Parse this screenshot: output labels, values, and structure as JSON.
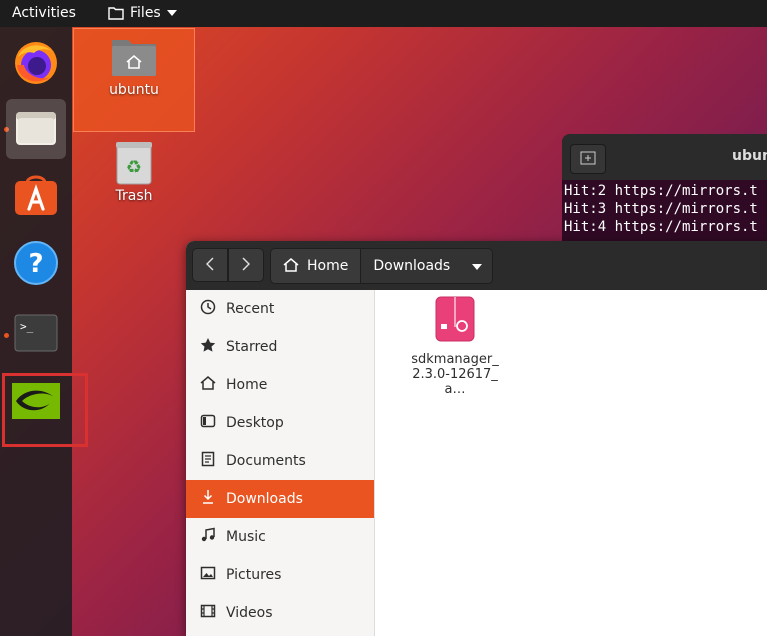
{
  "topbar": {
    "activities": "Activities",
    "app_menu": "Files"
  },
  "dock": {
    "items": [
      {
        "name": "Firefox",
        "icon": "firefox-icon"
      },
      {
        "name": "Files",
        "icon": "files-icon"
      },
      {
        "name": "Ubuntu Software",
        "icon": "software-icon"
      },
      {
        "name": "Help",
        "icon": "help-icon"
      },
      {
        "name": "Terminal",
        "icon": "terminal-icon"
      },
      {
        "name": "NVIDIA SDK Manager",
        "icon": "nvidia-icon"
      }
    ]
  },
  "desktop": {
    "icons": [
      {
        "label": "ubuntu",
        "icon": "home-folder-icon"
      },
      {
        "label": "Trash",
        "icon": "trash-icon"
      }
    ]
  },
  "terminal": {
    "title": "ubun",
    "lines": [
      "Hit:2 https://mirrors.t",
      "Hit:3 https://mirrors.t",
      "Hit:4 https://mirrors.t"
    ]
  },
  "files_window": {
    "breadcrumb": {
      "home": "Home",
      "current": "Downloads"
    },
    "sidebar": [
      {
        "label": "Recent",
        "icon": "clock-icon"
      },
      {
        "label": "Starred",
        "icon": "star-icon"
      },
      {
        "label": "Home",
        "icon": "home-icon"
      },
      {
        "label": "Desktop",
        "icon": "desktop-icon"
      },
      {
        "label": "Documents",
        "icon": "documents-icon"
      },
      {
        "label": "Downloads",
        "icon": "download-icon"
      },
      {
        "label": "Music",
        "icon": "music-icon"
      },
      {
        "label": "Pictures",
        "icon": "pictures-icon"
      },
      {
        "label": "Videos",
        "icon": "videos-icon"
      }
    ],
    "files": [
      {
        "name": "sdkmanager_2.3.0-12617_a…",
        "icon": "deb-package-icon"
      }
    ]
  },
  "colors": {
    "accent": "#e95420",
    "highlight_border": "#d9312f"
  }
}
